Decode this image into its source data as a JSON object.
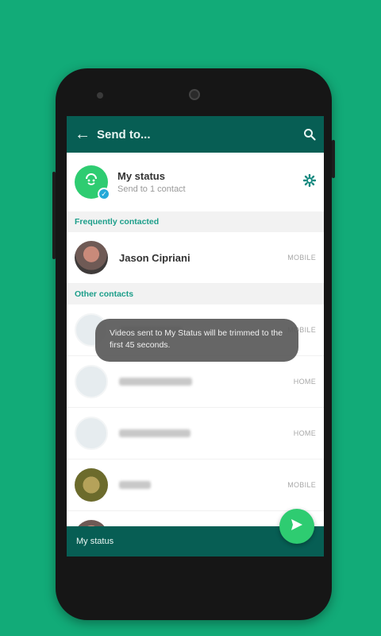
{
  "header": {
    "back_glyph": "←",
    "title": "Send to..."
  },
  "my_status": {
    "name": "My status",
    "subtitle": "Send to 1 contact",
    "badge_glyph": "✓"
  },
  "sections": {
    "frequent": "Frequently contacted",
    "other": "Other contacts"
  },
  "frequent_contacts": [
    {
      "name": "Jason Cipriani",
      "type": "MOBILE"
    }
  ],
  "other_contacts": [
    {
      "type": "MOBILE"
    },
    {
      "type": "HOME"
    },
    {
      "type": "HOME"
    },
    {
      "type": "MOBILE"
    }
  ],
  "toast": {
    "message": "Videos sent to My Status will be trimmed to the first 45 seconds."
  },
  "bottom_bar": {
    "label": "My status"
  },
  "colors": {
    "background": "#12ab78",
    "toolbar": "#075e54",
    "accent": "#2ecc71",
    "section_text": "#1c9e8a"
  },
  "icons": {
    "back": "arrow-left-icon",
    "search": "search-icon",
    "status": "status-camera-icon",
    "settings": "gear-icon",
    "send": "send-icon"
  }
}
